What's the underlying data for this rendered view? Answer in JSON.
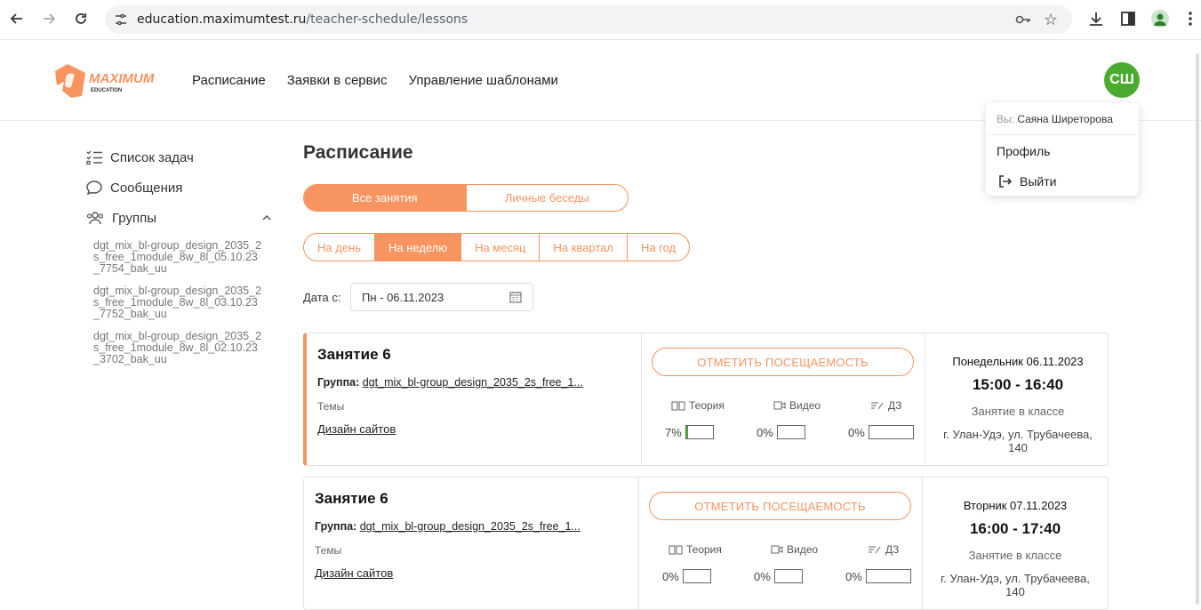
{
  "browser": {
    "url_host": "education.maximumtest.ru",
    "url_path": "/teacher-schedule/lessons"
  },
  "header": {
    "nav": [
      "Расписание",
      "Заявки в сервис",
      "Управление шаблонами"
    ],
    "avatar_initials": "СШ",
    "logo_text": "MAXIMUM",
    "logo_sub": "EDUCATION"
  },
  "dropdown": {
    "you_label": "Вы:",
    "user_name": "Саяна Ширеторова",
    "profile": "Профиль",
    "logout": "Выйти"
  },
  "sidebar": {
    "tasks": "Список задач",
    "messages": "Сообщения",
    "groups": "Группы",
    "group_links": [
      "dgt_mix_bl-group_design_2035_2s_free_1module_8w_8l_05.10.23_7754_bak_uu",
      "dgt_mix_bl-group_design_2035_2s_free_1module_8w_8l_03.10.23_7752_bak_uu",
      "dgt_mix_bl-group_design_2035_2s_free_1module_8w_8l_02.10.23_3702_bak_uu"
    ]
  },
  "main": {
    "title": "Расписание",
    "type_tabs": [
      "Все занятия",
      "Личные беседы"
    ],
    "period_tabs": [
      "На день",
      "На неделю",
      "На месяц",
      "На квартал",
      "На год"
    ],
    "date_label": "Дата с:",
    "date_value": "Пн - 06.11.2023"
  },
  "lessons": [
    {
      "title": "Занятие 6",
      "group_label": "Группа:",
      "group_value": "dgt_mix_bl-group_design_2035_2s_free_1...",
      "topics_label": "Темы",
      "topic": "Дизайн сайтов",
      "mark_button": "ОТМЕТИТЬ ПОСЕЩАЕМОСТЬ",
      "theory_label": "Теория",
      "video_label": "Видео",
      "hw_label": "ДЗ",
      "theory_pct": "7%",
      "video_pct": "0%",
      "hw_pct": "0%",
      "theory_fill": 0.07,
      "day": "Понедельник 06.11.2023",
      "time": "15:00 - 16:40",
      "kind": "Занятие в классе",
      "address": "г. Улан-Удэ, ул. Трубачеева, 140"
    },
    {
      "title": "Занятие 6",
      "group_label": "Группа:",
      "group_value": "dgt_mix_bl-group_design_2035_2s_free_1...",
      "topics_label": "Темы",
      "topic": "Дизайн сайтов",
      "mark_button": "ОТМЕТИТЬ ПОСЕЩАЕМОСТЬ",
      "theory_label": "Теория",
      "video_label": "Видео",
      "hw_label": "ДЗ",
      "theory_pct": "0%",
      "video_pct": "0%",
      "hw_pct": "0%",
      "theory_fill": 0,
      "day": "Вторник 07.11.2023",
      "time": "16:00 - 17:40",
      "kind": "Занятие в классе",
      "address": "г. Улан-Удэ, ул. Трубачеева, 140"
    }
  ],
  "colors": {
    "accent": "#f7945f",
    "avatar": "#4bab2f",
    "progress": "#4bab2f"
  }
}
